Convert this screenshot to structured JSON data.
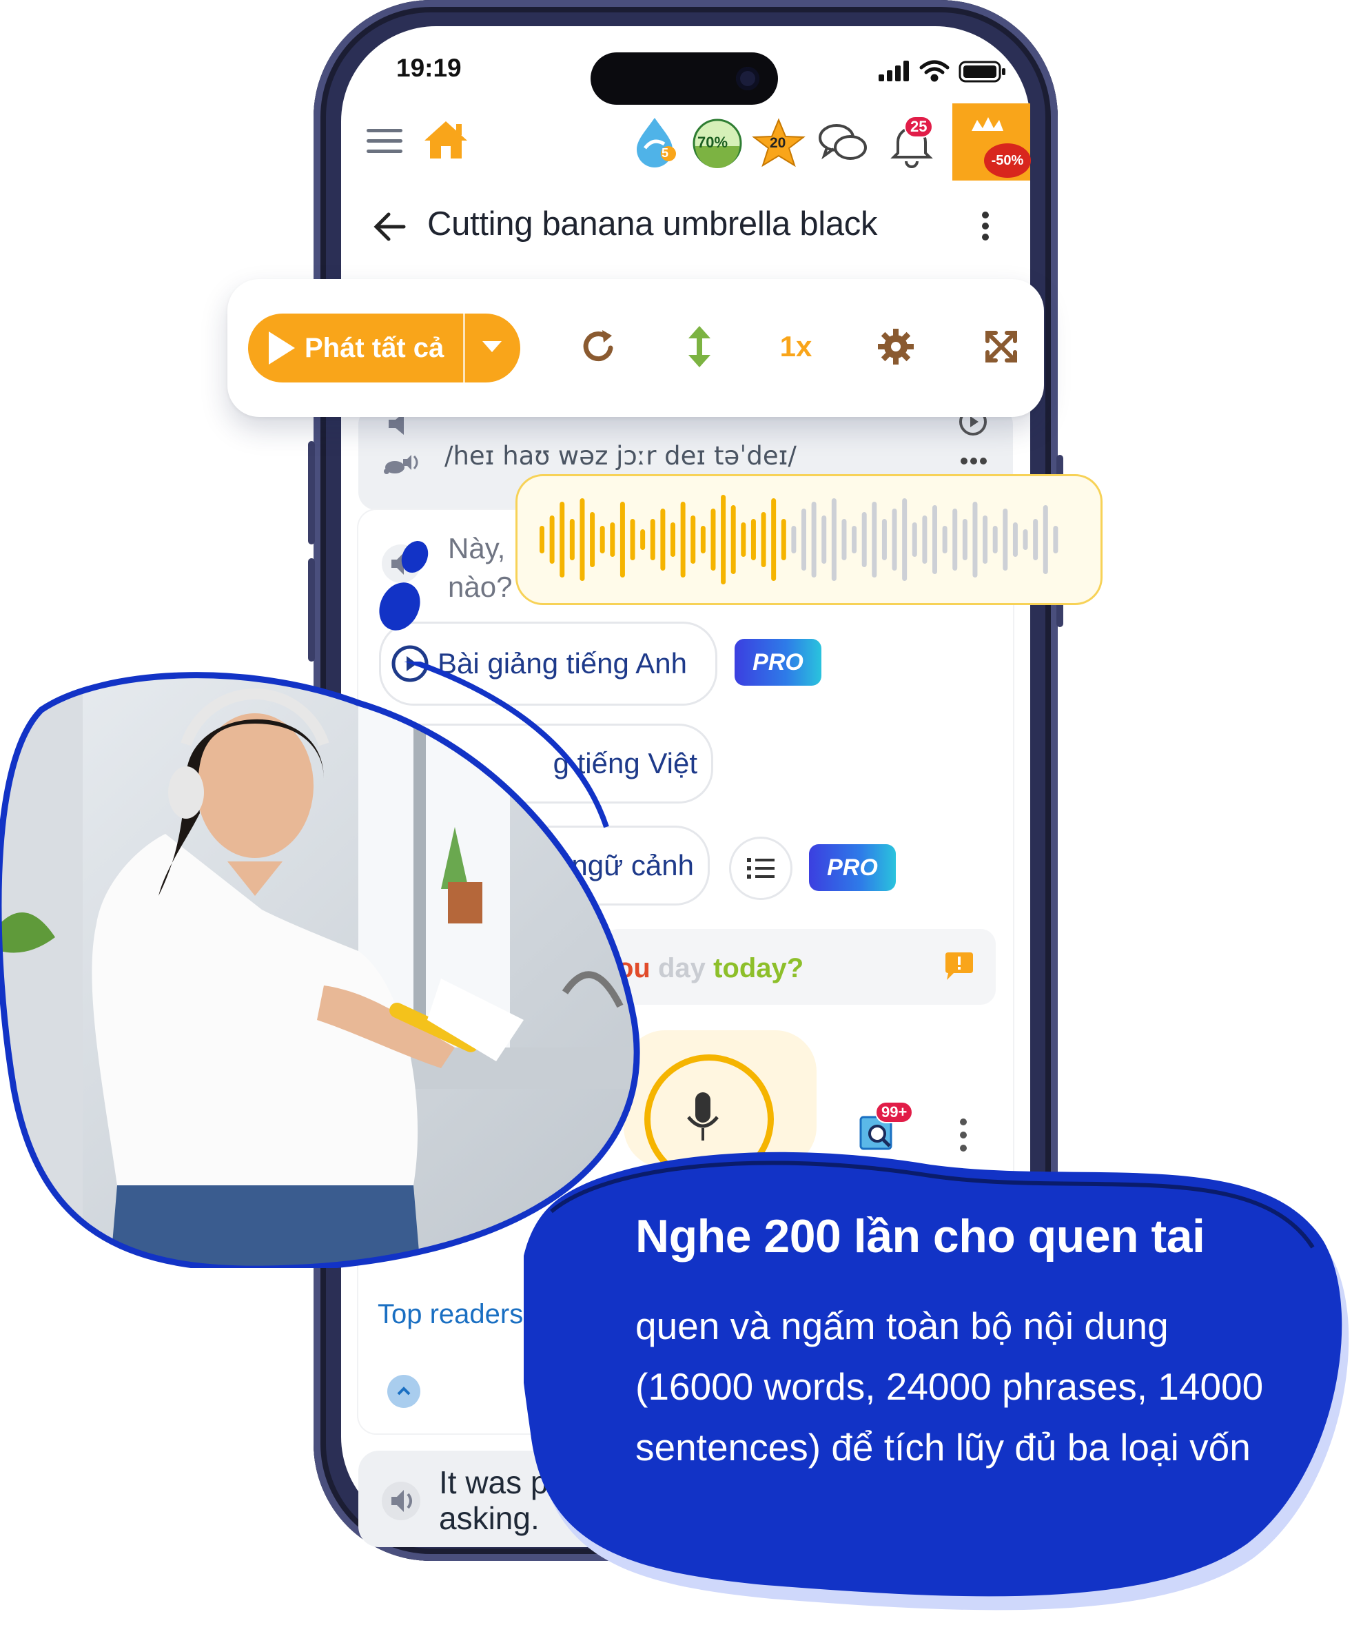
{
  "status": {
    "time": "19:19"
  },
  "topbar": {
    "badges": {
      "drop_level": "5",
      "progress": "70%",
      "stars": "20",
      "notifications": "25",
      "sale": "-50%"
    }
  },
  "header": {
    "title": "Cutting banana umbrella black"
  },
  "toolbar": {
    "play_label": "Phát tất cả",
    "speed": "1x"
  },
  "content": {
    "partial_sentence": "How was your day today?",
    "ipa": "/heɪ haʊ wəz jɔːr deɪ təˈdeɪ/",
    "vietnamese_prefix": "Này,",
    "vietnamese_suffix": "nào?",
    "lesson_buttons": [
      {
        "label": "Bài giảng tiếng Anh",
        "pro": "PRO"
      },
      {
        "label": "g tiếng Việt"
      },
      {
        "label": "ngữ cảnh",
        "pro": "PRO"
      }
    ],
    "sentence_words": [
      {
        "text": "ou",
        "color": "#e14b2a"
      },
      {
        "text": "day",
        "color": "#c9ccd2"
      },
      {
        "text": "today?",
        "color": "#8dbf2a"
      }
    ],
    "dictionary_badge": "99+",
    "top_readers": "Top readers",
    "bottom_text_line1": "It was p",
    "bottom_text_line2": "asking."
  },
  "promo": {
    "title": "Nghe 200 lần cho quen tai",
    "body": "quen và ngấm toàn bộ nội dung (16000 words, 24000 phrases, 14000 sentences) để tích lũy đủ ba loại vốn"
  },
  "colors": {
    "accent": "#f9a51a",
    "brand_blue": "#1233c6",
    "promo_text": "#ffffff"
  },
  "waveform": {
    "played_fraction": 0.47
  }
}
